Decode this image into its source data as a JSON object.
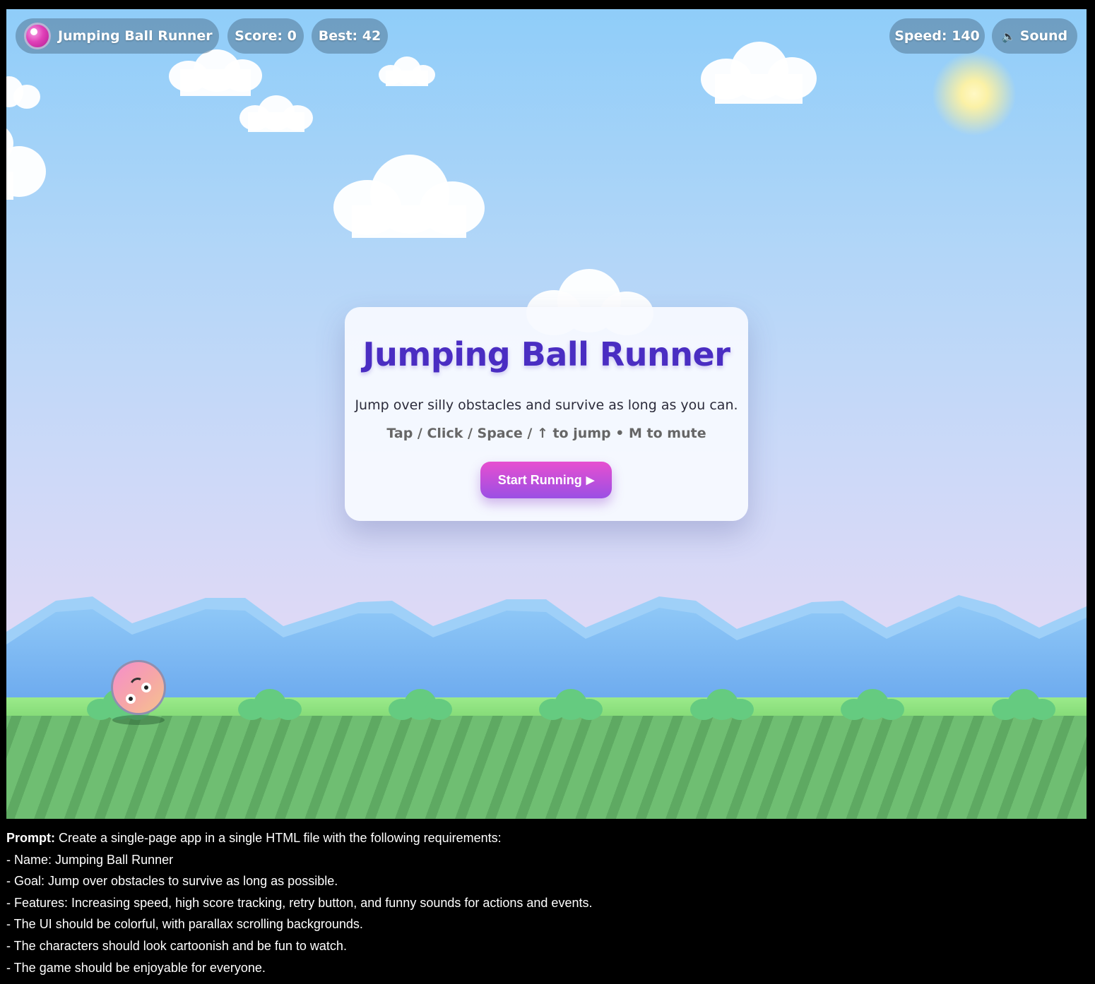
{
  "hud": {
    "title": "Jumping Ball Runner",
    "score": "Score: 0",
    "best": "Best: 42",
    "speed": "Speed: 140",
    "sound": "Sound",
    "sound_icon": "speaker-icon"
  },
  "start_panel": {
    "title": "Jumping Ball Runner",
    "description": "Jump over silly obstacles and survive as long as you can.",
    "controls": "Tap / Click / Space / ↑ to jump • M to mute",
    "start_button": "Start Running",
    "start_icon": "play-icon"
  },
  "prompt": {
    "label": "Prompt:",
    "intro": " Create a single-page app in a single HTML file with the following requirements:",
    "lines": [
      "- Name: Jumping Ball Runner",
      "- Goal: Jump over obstacles to survive as long as possible.",
      "- Features: Increasing speed, high score tracking, retry button, and funny sounds for actions and events.",
      "- The UI should be colorful, with parallax scrolling backgrounds.",
      "- The characters should look cartoonish and be fun to watch.",
      "- The game should be enjoyable for everyone."
    ]
  },
  "colors": {
    "sky_top": "#8fcdf9",
    "sky_bottom": "#e2dcf7",
    "title": "#4a2dc2",
    "button_top": "#e74fd0",
    "button_bottom": "#9b4fe4",
    "grass": "#86dc79",
    "bush": "#65cb80",
    "mountain": "#8ec7f5"
  }
}
